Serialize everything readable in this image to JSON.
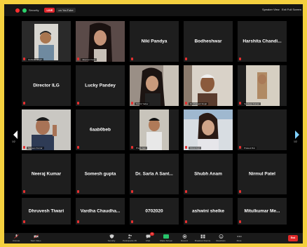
{
  "topbar": {
    "security": "Security",
    "live_badge": "LIVE",
    "on_youtube": "on YouTube",
    "speaker_view": "Speaker View",
    "exit_full_screen": "Exit Full Screen"
  },
  "tiles": [
    {
      "name": "",
      "caption": "Harkesh Singh",
      "video": true
    },
    {
      "name": "",
      "caption": "Jaspreet Kaur",
      "video": true
    },
    {
      "name": "Niki Pandya",
      "caption": ""
    },
    {
      "name": "Bodheshwar",
      "caption": ""
    },
    {
      "name": "Harshita Chandi...",
      "caption": ""
    },
    {
      "name": "Director ILG",
      "caption": ""
    },
    {
      "name": "Lucky Pandey",
      "caption": ""
    },
    {
      "name": "",
      "caption": "Srishti Yadav",
      "video": true
    },
    {
      "name": "",
      "caption": "Dr. Prakash Singh",
      "video": true
    },
    {
      "name": "",
      "caption": "Sandeep Kumar",
      "video": true
    },
    {
      "name": "",
      "caption": "Sanjeev Kumar",
      "video": true
    },
    {
      "name": "6aab0beb",
      "caption": ""
    },
    {
      "name": "",
      "caption": "Pratik Jain",
      "video": true
    },
    {
      "name": "",
      "caption": "Shruti Kori",
      "video": true
    },
    {
      "name": "",
      "caption": "Prateek Rai",
      "video": true
    },
    {
      "name": "Neeraj Kumar",
      "caption": ""
    },
    {
      "name": "Somesh gupta",
      "caption": ""
    },
    {
      "name": "Dr. Sarla A Sant...",
      "caption": ""
    },
    {
      "name": "Shubh Anam",
      "caption": ""
    },
    {
      "name": "Nirmul Patel",
      "caption": ""
    },
    {
      "name": "Dhruvesh Tiwari",
      "caption": ""
    },
    {
      "name": "Vardha Chaudha...",
      "caption": ""
    },
    {
      "name": "0702020",
      "caption": ""
    },
    {
      "name": "ashwini shelke",
      "caption": ""
    },
    {
      "name": "Mitulkumar Me...",
      "caption": ""
    }
  ],
  "pagination": {
    "left": "1/2",
    "right": "1/2"
  },
  "toolbar": {
    "unmute": "Unmute",
    "start_video": "Start Video",
    "security": "Security",
    "participants": "Participants",
    "participants_count": "35",
    "chat": "Chat",
    "chat_badge": "1",
    "share_screen": "Share Screen",
    "record": "Record",
    "breakout_rooms": "Breakout Rooms",
    "reactions": "Reactions",
    "more": "More",
    "end": "End"
  },
  "colors": {
    "background": "#f4d03f",
    "tile": "#1e1e1e",
    "active_speaker": "#b6ff47",
    "end_button": "#e02828"
  }
}
